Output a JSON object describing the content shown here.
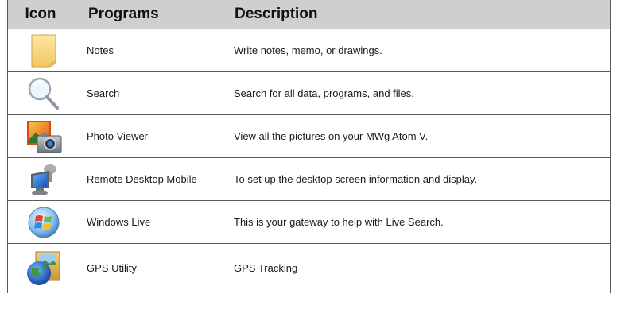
{
  "table": {
    "headers": {
      "icon": "Icon",
      "programs": "Programs",
      "description": "Description"
    },
    "rows": [
      {
        "icon": "notes-icon",
        "program": "Notes",
        "description": "Write notes, memo, or drawings."
      },
      {
        "icon": "search-icon",
        "program": "Search",
        "description": "Search for all data, programs, and files."
      },
      {
        "icon": "photo-viewer-icon",
        "program": "Photo Viewer",
        "description": "View all the pictures on your MWg Atom V."
      },
      {
        "icon": "remote-desktop-icon",
        "program": "Remote Desktop Mobile",
        "description": "To set up the desktop screen information and display."
      },
      {
        "icon": "windows-live-icon",
        "program": "Windows Live",
        "description": "This is your gateway to help with Live Search."
      },
      {
        "icon": "gps-utility-icon",
        "program": "GPS Utility",
        "description": "GPS Tracking"
      }
    ]
  }
}
